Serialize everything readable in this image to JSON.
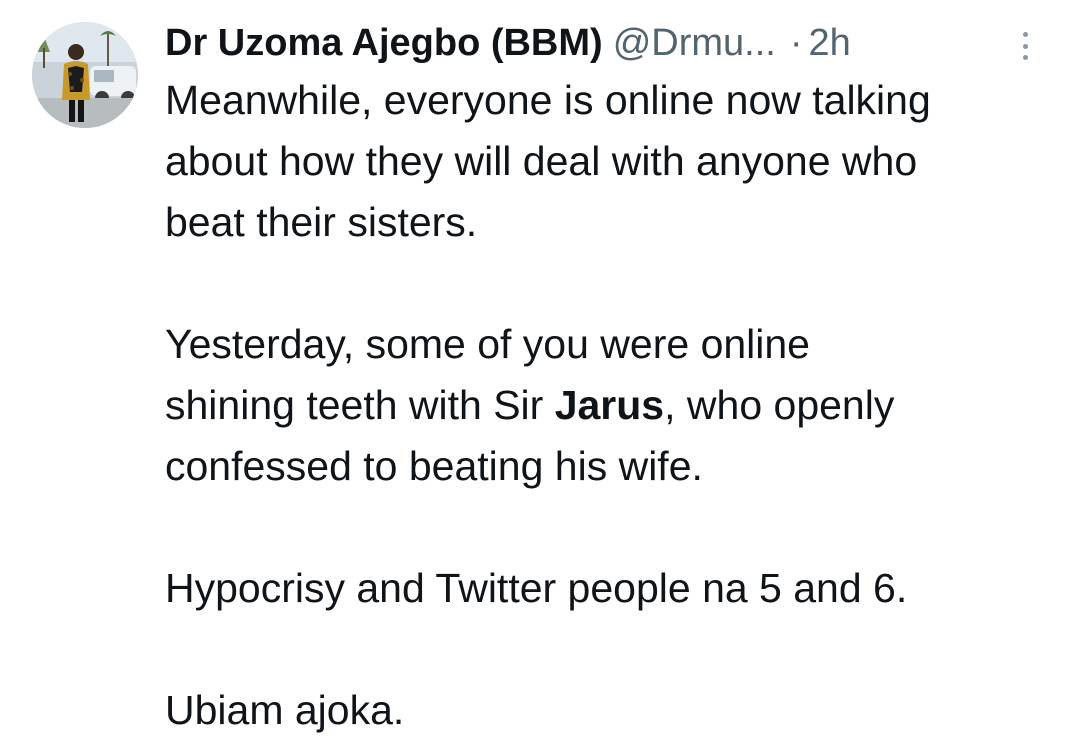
{
  "tweet": {
    "author": {
      "display_name": "Dr Uzoma Ajegbo (BBM)",
      "handle": "@Drmu...",
      "avatar_icon": "profile-photo"
    },
    "separator": "·",
    "time": "2h",
    "more_icon": "vertical-ellipsis-icon",
    "paragraphs": [
      {
        "lines": [
          "Meanwhile, everyone is online now talking",
          "about how they will deal with anyone who",
          "beat their sisters."
        ]
      },
      {
        "line1": "Yesterday, some of you were online",
        "line2_before": "shining teeth with Sir ",
        "line2_bold": "Jarus",
        "line2_after": ", who openly",
        "line3": "confessed to beating his wife."
      },
      {
        "text": "Hypocrisy and Twitter people na 5 and 6."
      },
      {
        "text": "Ubiam ajoka."
      }
    ]
  },
  "colors": {
    "text": "#0f1419",
    "secondary": "#536471",
    "background": "#ffffff"
  }
}
